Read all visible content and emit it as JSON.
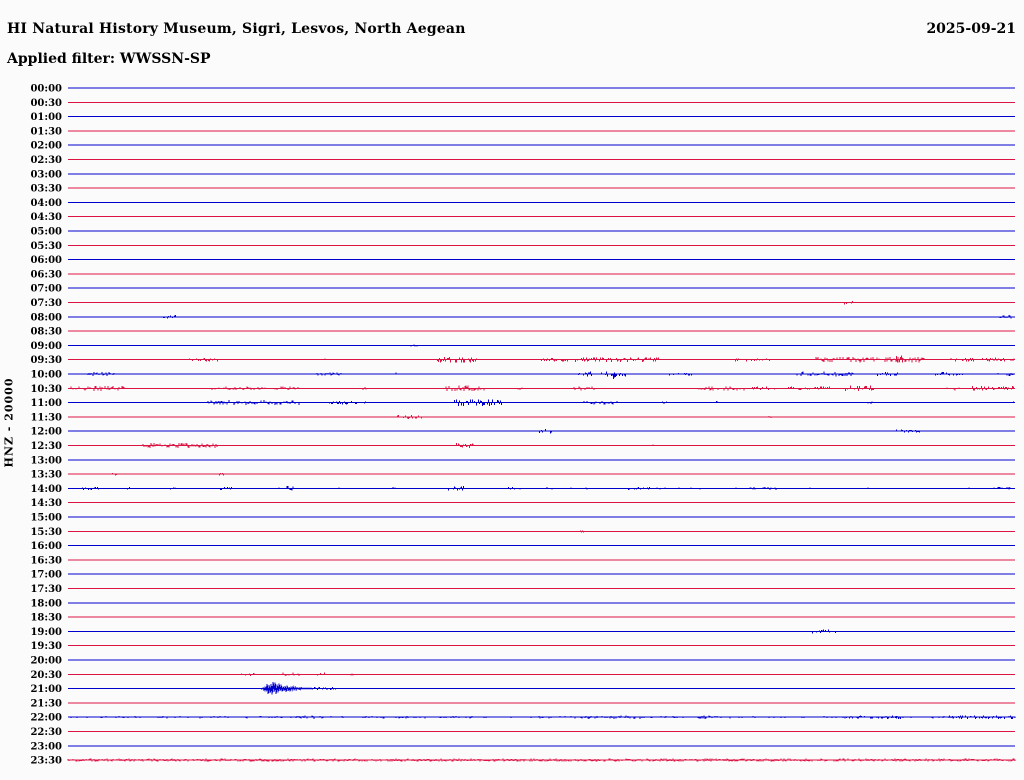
{
  "header": {
    "title": "HI Natural History Museum, Sigri, Lesvos, North Aegean",
    "date": "2025-09-21",
    "filter_line": "Applied filter: WWSSN-SP"
  },
  "chart_data": {
    "type": "line",
    "subtype": "helicorder-day-plot",
    "title": "HI Natural History Museum, Sigri, Lesvos, North Aegean",
    "date": "2025-09-21",
    "filter": "WWSSN-SP",
    "channel_label": "HNZ - 20000",
    "row_interval_minutes": 30,
    "x_range_minutes": [
      0,
      30
    ],
    "legend_position": "none",
    "grid": false,
    "colors": {
      "blue": "#0000cd",
      "red": "#dc1444"
    },
    "notes": "48 alternating blue/red half-hour traces; segments are [startFrac, endFrac, amplitudePx, density, type?] of noise along each trace; large event burst on the 21:00 trace",
    "rows": [
      {
        "label": "00:00",
        "color": "blue",
        "segments": []
      },
      {
        "label": "00:30",
        "color": "red",
        "segments": []
      },
      {
        "label": "01:00",
        "color": "blue",
        "segments": []
      },
      {
        "label": "01:30",
        "color": "red",
        "segments": []
      },
      {
        "label": "02:00",
        "color": "blue",
        "segments": []
      },
      {
        "label": "02:30",
        "color": "red",
        "segments": []
      },
      {
        "label": "03:00",
        "color": "blue",
        "segments": []
      },
      {
        "label": "03:30",
        "color": "red",
        "segments": []
      },
      {
        "label": "04:00",
        "color": "blue",
        "segments": []
      },
      {
        "label": "04:30",
        "color": "red",
        "segments": []
      },
      {
        "label": "05:00",
        "color": "blue",
        "segments": []
      },
      {
        "label": "05:30",
        "color": "red",
        "segments": []
      },
      {
        "label": "06:00",
        "color": "blue",
        "segments": []
      },
      {
        "label": "06:30",
        "color": "red",
        "segments": []
      },
      {
        "label": "07:00",
        "color": "blue",
        "segments": []
      },
      {
        "label": "07:30",
        "color": "red",
        "segments": [
          [
            0.82,
            0.83,
            2,
            0.5
          ]
        ]
      },
      {
        "label": "08:00",
        "color": "blue",
        "segments": [
          [
            0.1,
            0.115,
            2,
            0.5
          ],
          [
            0.984,
            0.999,
            2,
            0.6
          ]
        ]
      },
      {
        "label": "08:30",
        "color": "red",
        "segments": []
      },
      {
        "label": "09:00",
        "color": "blue",
        "segments": [
          [
            0.36,
            0.37,
            1.5,
            0.4
          ]
        ]
      },
      {
        "label": "09:30",
        "color": "red",
        "segments": [
          [
            0.126,
            0.158,
            2,
            0.5
          ],
          [
            0.266,
            0.272,
            1.5,
            0.4
          ],
          [
            0.39,
            0.432,
            3,
            0.6
          ],
          [
            0.497,
            0.53,
            2,
            0.5
          ],
          [
            0.536,
            0.625,
            2.5,
            0.55
          ],
          [
            0.705,
            0.745,
            2,
            0.5
          ],
          [
            0.79,
            0.905,
            3,
            0.65
          ],
          [
            0.875,
            0.882,
            5,
            0.9
          ],
          [
            0.93,
            0.99,
            2,
            0.5
          ],
          [
            0.996,
            1.0,
            2,
            0.6
          ]
        ]
      },
      {
        "label": "10:00",
        "color": "blue",
        "segments": [
          [
            0.02,
            0.05,
            2,
            0.5
          ],
          [
            0.262,
            0.3,
            2,
            0.5
          ],
          [
            0.343,
            0.348,
            1.5,
            0.5
          ],
          [
            0.535,
            0.59,
            2.5,
            0.55
          ],
          [
            0.576,
            0.579,
            7,
            1
          ],
          [
            0.63,
            0.66,
            1.5,
            0.4
          ],
          [
            0.77,
            0.83,
            2.5,
            0.5
          ],
          [
            0.855,
            0.877,
            2,
            0.5
          ],
          [
            0.916,
            0.945,
            2,
            0.5
          ],
          [
            0.98,
            1.0,
            2,
            0.5
          ]
        ]
      },
      {
        "label": "10:30",
        "color": "red",
        "segments": [
          [
            0.002,
            0.06,
            2.5,
            0.6
          ],
          [
            0.148,
            0.245,
            2,
            0.45
          ],
          [
            0.306,
            0.315,
            2,
            0.5
          ],
          [
            0.398,
            0.44,
            3,
            0.6
          ],
          [
            0.475,
            0.48,
            2,
            0.5
          ],
          [
            0.532,
            0.556,
            2,
            0.45
          ],
          [
            0.665,
            0.715,
            2.5,
            0.55
          ],
          [
            0.722,
            0.747,
            2,
            0.5
          ],
          [
            0.76,
            0.805,
            2,
            0.5
          ],
          [
            0.82,
            0.852,
            3,
            0.6
          ],
          [
            0.928,
            0.942,
            2,
            0.5
          ],
          [
            0.955,
            1.0,
            2.5,
            0.6
          ]
        ]
      },
      {
        "label": "11:00",
        "color": "blue",
        "segments": [
          [
            0.148,
            0.245,
            2.5,
            0.6
          ],
          [
            0.275,
            0.315,
            2,
            0.5
          ],
          [
            0.408,
            0.458,
            3.5,
            0.7
          ],
          [
            0.545,
            0.58,
            2,
            0.5
          ],
          [
            0.628,
            0.636,
            1.5,
            0.5
          ],
          [
            0.685,
            0.69,
            1.5,
            0.4
          ],
          [
            0.845,
            0.85,
            1.5,
            0.4
          ],
          [
            0.965,
            0.972,
            1.5,
            0.4
          ],
          [
            0.995,
            1.0,
            1.5,
            0.5
          ]
        ]
      },
      {
        "label": "11:30",
        "color": "red",
        "segments": [
          [
            0.348,
            0.375,
            2,
            0.5
          ],
          [
            0.558,
            0.565,
            1.5,
            0.4
          ],
          [
            0.738,
            0.743,
            1.5,
            0.4
          ]
        ]
      },
      {
        "label": "12:00",
        "color": "blue",
        "segments": [
          [
            0.498,
            0.512,
            2.5,
            0.7
          ],
          [
            0.875,
            0.9,
            1.8,
            0.5
          ]
        ]
      },
      {
        "label": "12:30",
        "color": "red",
        "segments": [
          [
            0.078,
            0.158,
            2.5,
            0.75
          ],
          [
            0.41,
            0.428,
            2.5,
            0.85
          ],
          [
            0.618,
            0.625,
            1.5,
            0.4
          ]
        ]
      },
      {
        "label": "13:00",
        "color": "blue",
        "segments": []
      },
      {
        "label": "13:30",
        "color": "red",
        "segments": [
          [
            0.046,
            0.052,
            1.8,
            0.5
          ],
          [
            0.16,
            0.166,
            1.8,
            0.5
          ]
        ]
      },
      {
        "label": "14:00",
        "color": "blue",
        "segments": [
          [
            0.0,
            1.0,
            1,
            0.08
          ],
          [
            0.012,
            0.035,
            2,
            0.5
          ],
          [
            0.063,
            0.068,
            1.8,
            0.5
          ],
          [
            0.105,
            0.112,
            1.5,
            0.5
          ],
          [
            0.16,
            0.176,
            1.5,
            0.4
          ],
          [
            0.23,
            0.238,
            2.5,
            0.7
          ],
          [
            0.342,
            0.348,
            1.5,
            0.5
          ],
          [
            0.402,
            0.42,
            2.5,
            0.6
          ],
          [
            0.465,
            0.472,
            1.5,
            0.5
          ],
          [
            0.505,
            0.512,
            1.8,
            0.5
          ],
          [
            0.543,
            0.548,
            1.5,
            0.5
          ],
          [
            0.592,
            0.615,
            1.5,
            0.4
          ],
          [
            0.72,
            0.748,
            1.8,
            0.45
          ],
          [
            0.982,
            0.995,
            1.8,
            0.5
          ]
        ]
      },
      {
        "label": "14:30",
        "color": "red",
        "segments": []
      },
      {
        "label": "15:00",
        "color": "blue",
        "segments": []
      },
      {
        "label": "15:30",
        "color": "red",
        "segments": [
          [
            0.54,
            0.545,
            1.5,
            0.4
          ]
        ]
      },
      {
        "label": "16:00",
        "color": "blue",
        "segments": []
      },
      {
        "label": "16:30",
        "color": "red",
        "segments": []
      },
      {
        "label": "17:00",
        "color": "blue",
        "segments": []
      },
      {
        "label": "17:30",
        "color": "red",
        "segments": []
      },
      {
        "label": "18:00",
        "color": "blue",
        "segments": []
      },
      {
        "label": "18:30",
        "color": "red",
        "segments": []
      },
      {
        "label": "19:00",
        "color": "blue",
        "segments": [
          [
            0.785,
            0.815,
            2,
            0.45
          ]
        ]
      },
      {
        "label": "19:30",
        "color": "red",
        "segments": []
      },
      {
        "label": "20:00",
        "color": "blue",
        "segments": []
      },
      {
        "label": "20:30",
        "color": "red",
        "segments": [
          [
            0.182,
            0.2,
            1.8,
            0.45
          ],
          [
            0.222,
            0.245,
            1.8,
            0.45
          ],
          [
            0.255,
            0.272,
            1.8,
            0.45
          ],
          [
            0.298,
            0.304,
            1.5,
            0.4
          ]
        ]
      },
      {
        "label": "21:00",
        "color": "blue",
        "segments": [
          [
            0.205,
            0.258,
            8,
            1,
            "burst"
          ],
          [
            0.258,
            0.285,
            1.5,
            0.8
          ]
        ]
      },
      {
        "label": "21:30",
        "color": "red",
        "segments": []
      },
      {
        "label": "22:00",
        "color": "blue",
        "segments": [
          [
            0.0,
            1.0,
            1.2,
            0.3
          ],
          [
            0.245,
            0.27,
            1.8,
            0.5
          ],
          [
            0.545,
            0.605,
            2,
            0.5
          ],
          [
            0.665,
            0.7,
            1.8,
            0.5
          ],
          [
            0.82,
            0.88,
            1.8,
            0.45
          ],
          [
            0.93,
            1.0,
            2,
            0.5
          ]
        ]
      },
      {
        "label": "22:30",
        "color": "red",
        "segments": []
      },
      {
        "label": "23:00",
        "color": "blue",
        "segments": []
      },
      {
        "label": "23:30",
        "color": "red",
        "segments": [
          [
            0.0,
            1.0,
            1.5,
            0.85
          ]
        ]
      }
    ]
  }
}
